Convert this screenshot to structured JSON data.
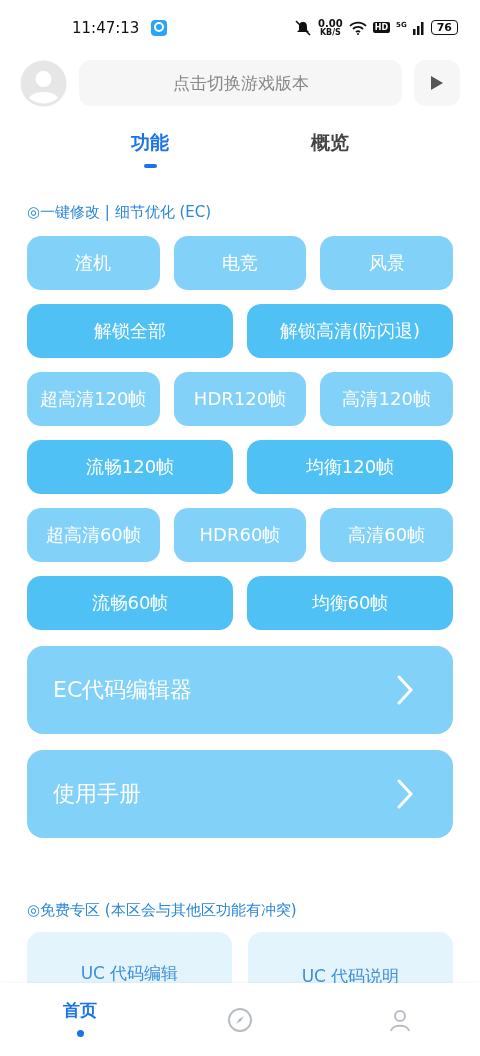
{
  "status_bar": {
    "time": "11:47:13",
    "net_speed": "0.00",
    "net_unit": "KB/S",
    "hd": "HD",
    "network": "5G",
    "battery": "76"
  },
  "header": {
    "search": {
      "placeholder": "点击切换游戏版本"
    }
  },
  "tabs": [
    {
      "label": "功能",
      "selected": true
    },
    {
      "label": "概览",
      "selected": false
    }
  ],
  "section_1": {
    "title": "◎一键修改 | 细节优化 (EC)",
    "button_rows": [
      [
        {
          "label": "渣机",
          "kind": "light"
        },
        {
          "label": "电竞",
          "kind": "light"
        },
        {
          "label": "风景",
          "kind": "light"
        }
      ],
      [
        {
          "label": "解锁全部",
          "kind": "strong"
        },
        {
          "label": "解锁高清(防闪退)",
          "kind": "strong"
        }
      ],
      [
        {
          "label": "超高清120帧",
          "kind": "light"
        },
        {
          "label": "HDR120帧",
          "kind": "light"
        },
        {
          "label": "高清120帧",
          "kind": "light"
        }
      ],
      [
        {
          "label": "流畅120帧",
          "kind": "strong"
        },
        {
          "label": "均衡120帧",
          "kind": "strong"
        }
      ],
      [
        {
          "label": "超高清60帧",
          "kind": "light"
        },
        {
          "label": "HDR60帧",
          "kind": "light"
        },
        {
          "label": "高清60帧",
          "kind": "light"
        }
      ],
      [
        {
          "label": "流畅60帧",
          "kind": "strong"
        },
        {
          "label": "均衡60帧",
          "kind": "strong"
        }
      ]
    ],
    "links": [
      {
        "label": "EC代码编辑器"
      },
      {
        "label": "使用手册"
      }
    ]
  },
  "section_2": {
    "title": "◎免费专区 (本区会与其他区功能有冲突)",
    "cards": [
      {
        "label": "UC 代码编辑"
      },
      {
        "label": "UC 代码说明"
      }
    ]
  },
  "bottom_nav": [
    {
      "label": "首页",
      "kind": "home",
      "selected": true
    },
    {
      "kind": "compass",
      "selected": false
    },
    {
      "kind": "profile",
      "selected": false
    }
  ]
}
